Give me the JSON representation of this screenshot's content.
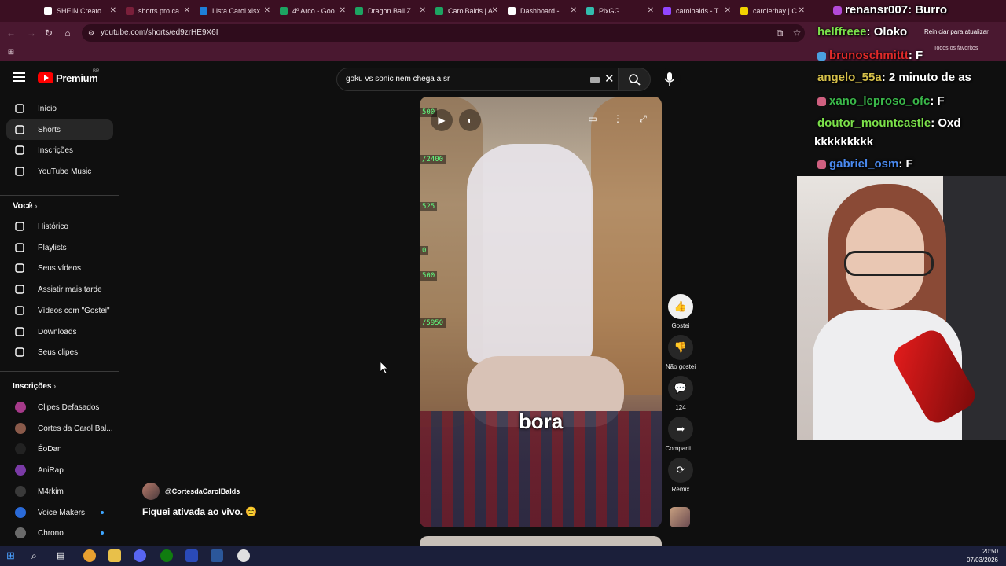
{
  "browser": {
    "tabs": [
      {
        "label": "SHEIN Creato",
        "color": "#ffffff"
      },
      {
        "label": "shorts pro ca",
        "color": "#7a1f3a"
      },
      {
        "label": "Lista Carol.xlsx",
        "color": "#1e7fd8"
      },
      {
        "label": "4º Arco - Goo",
        "color": "#1da462"
      },
      {
        "label": "Dragon Ball Z",
        "color": "#1da462"
      },
      {
        "label": "CarolBalds | A",
        "color": "#1da462"
      },
      {
        "label": "Dashboard - ",
        "color": "#ffffff"
      },
      {
        "label": "PixGG",
        "color": "#32bcad"
      },
      {
        "label": "carolbalds - T",
        "color": "#9146ff"
      },
      {
        "label": "carolerhay | C",
        "color": "#f2d200"
      }
    ],
    "url": "youtube.com/shorts/ed9zrHE9X6I",
    "reload_banner": "Reiniciar para atualizar",
    "favorites_label": "Todos os favoritos"
  },
  "youtube": {
    "brand": "Premium",
    "country": "BR",
    "search_query": "goku vs sonic nem chega a sr",
    "sidebar": {
      "main": [
        {
          "label": "Início",
          "icon": "home-icon"
        },
        {
          "label": "Shorts",
          "icon": "shorts-icon",
          "active": true
        },
        {
          "label": "Inscrições",
          "icon": "subscriptions-icon"
        },
        {
          "label": "YouTube Music",
          "icon": "music-icon"
        }
      ],
      "you_title": "Você",
      "you": [
        {
          "label": "Histórico",
          "icon": "history-icon"
        },
        {
          "label": "Playlists",
          "icon": "playlists-icon"
        },
        {
          "label": "Seus vídeos",
          "icon": "your-videos-icon"
        },
        {
          "label": "Assistir mais tarde",
          "icon": "watch-later-icon"
        },
        {
          "label": "Vídeos com \"Gostei\"",
          "icon": "liked-icon"
        },
        {
          "label": "Downloads",
          "icon": "download-icon"
        },
        {
          "label": "Seus clipes",
          "icon": "clips-icon"
        }
      ],
      "subs_title": "Inscrições",
      "subs": [
        {
          "label": "Clipes Defasados",
          "color": "#a63a8a",
          "dot": false
        },
        {
          "label": "Cortes da Carol Bal...",
          "color": "#8a5a4a",
          "dot": false
        },
        {
          "label": "ÉoDan",
          "color": "#222222",
          "dot": false
        },
        {
          "label": "AniRap",
          "color": "#7a3aa6",
          "dot": false
        },
        {
          "label": "M4rkim",
          "color": "#3a3a3a",
          "dot": false
        },
        {
          "label": "Voice Makers",
          "color": "#2a6ad8",
          "dot": true
        },
        {
          "label": "Chrono",
          "color": "#6a6a6a",
          "dot": true
        }
      ]
    },
    "short": {
      "caption": "bora",
      "hud": [
        "500",
        "/2400",
        "525",
        "0",
        "500",
        "/5950"
      ],
      "author": "@CortesdaCarolBalds",
      "description": "Fiquei ativada ao vivo. 😊",
      "actions": [
        {
          "label": "Gostei",
          "icon": "like-icon",
          "glyph": "👍",
          "white": true
        },
        {
          "label": "Não gostei",
          "icon": "dislike-icon",
          "glyph": "👎",
          "white": false
        },
        {
          "label": "124",
          "icon": "comments-icon",
          "glyph": "💬",
          "white": false
        },
        {
          "label": "Comparti...",
          "icon": "share-icon",
          "glyph": "➦",
          "white": false
        },
        {
          "label": "Remix",
          "icon": "remix-icon",
          "glyph": "⟳",
          "white": false
        }
      ]
    }
  },
  "stream_chat": [
    {
      "user": "renansr007",
      "text": ": Burro",
      "color": "#ffffff",
      "badge": "#b34ad8"
    },
    {
      "user": "helffreee",
      "text": ": Oloko",
      "color": "#7be04a",
      "badge": ""
    },
    {
      "user": "brunoschmittt",
      "text": ": F",
      "color": "#e02a2a",
      "badge": "#4aa0e0"
    },
    {
      "user": "angelo_55a",
      "text": ": 2 minuto de as",
      "color": "#d6c04a",
      "badge": ""
    },
    {
      "user": "xano_leproso_ofc",
      "text": ": F",
      "color": "#3ab84a",
      "badge": "#d06080"
    },
    {
      "user": "doutor_mountcastle",
      "text": ": Oxd",
      "color": "#7be04a",
      "badge": ""
    },
    {
      "user": "",
      "text": "kkkkkkkkk",
      "color": "#ffffff",
      "badge": ""
    },
    {
      "user": "gabriel_osm",
      "text": ": F",
      "color": "#4a8af0",
      "badge": "#d06080"
    }
  ],
  "clock": {
    "time": "20:50",
    "date": "07/03/2026"
  }
}
